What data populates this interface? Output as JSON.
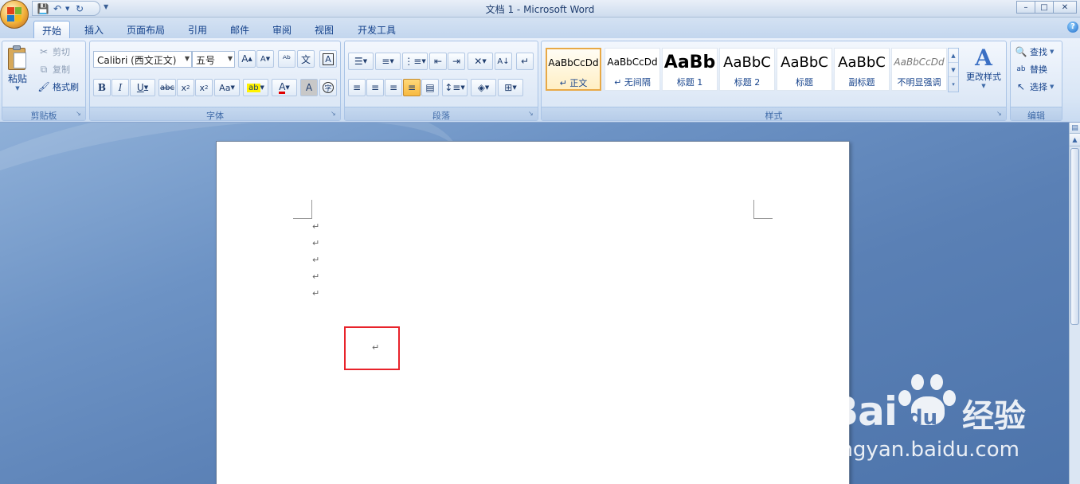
{
  "window": {
    "title": "文档 1 - Microsoft Word",
    "minimize": "–",
    "maximize": "□",
    "close": "✕"
  },
  "tabs": [
    {
      "label": "开始",
      "active": true
    },
    {
      "label": "插入"
    },
    {
      "label": "页面布局"
    },
    {
      "label": "引用"
    },
    {
      "label": "邮件"
    },
    {
      "label": "审阅"
    },
    {
      "label": "视图"
    },
    {
      "label": "开发工具"
    }
  ],
  "clipboard": {
    "group_label": "剪贴板",
    "paste": "粘贴",
    "cut": "剪切",
    "copy": "复制",
    "format_painter": "格式刷"
  },
  "font": {
    "group_label": "字体",
    "font_name": "Calibri (西文正文)",
    "font_size": "五号"
  },
  "paragraph": {
    "group_label": "段落"
  },
  "styles": {
    "group_label": "样式",
    "items": [
      {
        "sample": "AaBbCcDd",
        "name": "↵ 正文",
        "selected": true
      },
      {
        "sample": "AaBbCcDd",
        "name": "↵ 无间隔"
      },
      {
        "sample": "AaBb",
        "name": "标题 1"
      },
      {
        "sample": "AaBbC",
        "name": "标题 2"
      },
      {
        "sample": "AaBbC",
        "name": "标题"
      },
      {
        "sample": "AaBbC",
        "name": "副标题"
      },
      {
        "sample": "AaBbCcDd",
        "name": "不明显强调"
      }
    ],
    "change_styles": "更改样式"
  },
  "editing": {
    "group_label": "编辑",
    "find": "查找",
    "replace": "替换",
    "select": "选择"
  },
  "document": {
    "paragraph_mark": "↵"
  },
  "watermark": {
    "brand": "Bai",
    "du": "du",
    "cn": "经验",
    "url": "jingyan.baidu.com"
  },
  "colors": {
    "accent": "#15428b",
    "highlight_box": "#e8232b",
    "ribbon": "#dde8f6"
  }
}
